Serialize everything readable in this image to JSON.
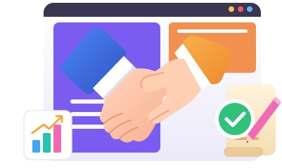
{
  "illustration": {
    "subject": "handshake-agreement",
    "icons": [
      "handshake-icon",
      "growth-chart-icon",
      "checkmark-badge-icon",
      "pencil-icon",
      "document-icon"
    ]
  },
  "window": {
    "controls": [
      "yellow-dot",
      "red-dot",
      "blue-dot"
    ]
  },
  "colors": {
    "window_frame": "#3A3550",
    "window_body": "#E9E7F8",
    "left_panel": "#7B5CF0",
    "right_panel": "#F2904F",
    "sleeve_blue": "#3F6FE0",
    "sleeve_orange": "#F3A23C",
    "hand_skin": "#FFC8A8",
    "check_green": "#2FC27A",
    "pencil_pink": "#F06AB4",
    "chart_bar_1": "#3CA8F2",
    "chart_bar_2": "#27C4B0",
    "chart_bar_3": "#F06AB4",
    "chart_arrow": "#F4A93A"
  }
}
